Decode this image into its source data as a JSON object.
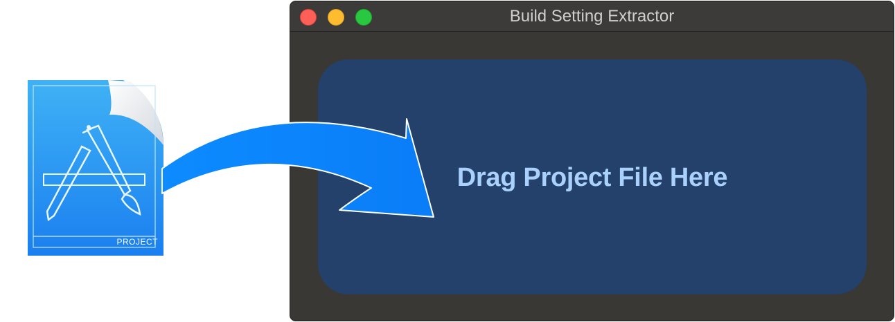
{
  "window": {
    "title": "Build Setting Extractor",
    "buttons": {
      "close_color": "#fe5f57",
      "minimize_color": "#febc2e",
      "zoom_color": "#28c840"
    }
  },
  "drop_zone": {
    "label": "Drag Project File Here",
    "background_color": "#23416a",
    "text_color": "#a9d1fb"
  },
  "file_icon": {
    "label": "PROJECT",
    "icon": "xcode-project-file-icon"
  },
  "arrow": {
    "icon": "curved-arrow-icon",
    "color": "#0a84ff"
  }
}
